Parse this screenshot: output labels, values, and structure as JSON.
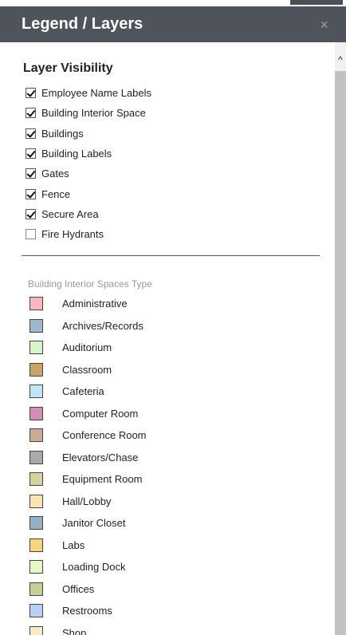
{
  "panel": {
    "title": "Legend / Layers",
    "close_icon": "×"
  },
  "layers": {
    "heading": "Layer Visibility",
    "items": [
      {
        "label": "Employee Name Labels",
        "checked": true
      },
      {
        "label": "Building Interior Space",
        "checked": true
      },
      {
        "label": "Buildings",
        "checked": true
      },
      {
        "label": "Building Labels",
        "checked": true
      },
      {
        "label": "Gates",
        "checked": true
      },
      {
        "label": "Fence",
        "checked": true
      },
      {
        "label": "Secure Area",
        "checked": true
      },
      {
        "label": "Fire Hydrants",
        "checked": false
      }
    ]
  },
  "legend": {
    "heading": "Building Interior Spaces Type",
    "items": [
      {
        "label": "Administrative",
        "color": "#f4b8be"
      },
      {
        "label": "Archives/Records",
        "color": "#a1b8cc"
      },
      {
        "label": "Auditorium",
        "color": "#d5f7c8"
      },
      {
        "label": "Classroom",
        "color": "#c8a566"
      },
      {
        "label": "Cafeteria",
        "color": "#bfe6f2"
      },
      {
        "label": "Computer Room",
        "color": "#d090b4"
      },
      {
        "label": "Conference Room",
        "color": "#ccab94"
      },
      {
        "label": "Elevators/Chase",
        "color": "#aaaaaa"
      },
      {
        "label": "Equipment Room",
        "color": "#d4d39b"
      },
      {
        "label": "Hall/Lobby",
        "color": "#fce3b0"
      },
      {
        "label": "Janitor Closet",
        "color": "#97afc4"
      },
      {
        "label": "Labs",
        "color": "#f8d27c"
      },
      {
        "label": "Loading Dock",
        "color": "#e8f8c2"
      },
      {
        "label": "Offices",
        "color": "#c5cf95"
      },
      {
        "label": "Restrooms",
        "color": "#b9d1f6"
      },
      {
        "label": "Shop",
        "color": "#f8eac5"
      }
    ]
  },
  "scrollbar": {
    "up_icon": "^"
  }
}
